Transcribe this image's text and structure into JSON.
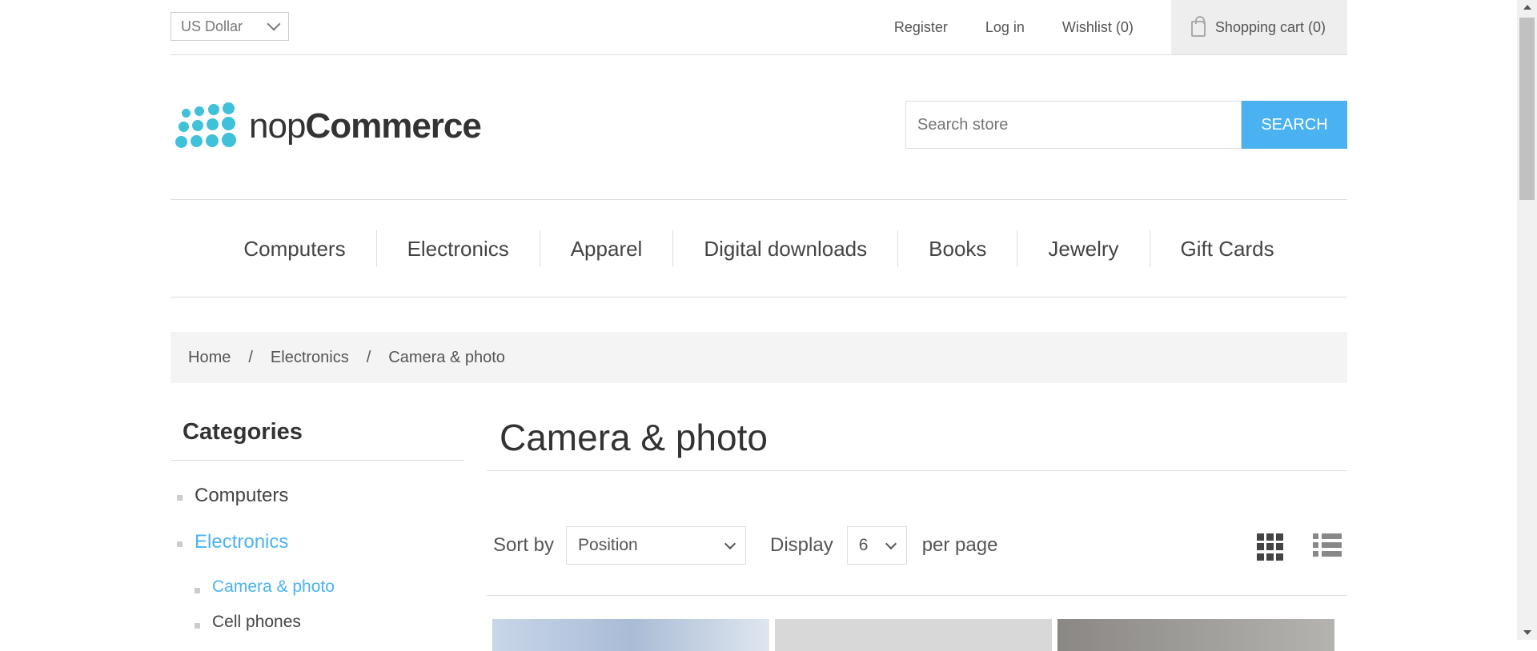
{
  "header": {
    "currency": "US Dollar",
    "links": {
      "register": "Register",
      "login": "Log in",
      "wishlist": "Wishlist (0)",
      "cart": "Shopping cart (0)"
    },
    "logo": {
      "prefix": "nop",
      "bold": "Commerce"
    },
    "search": {
      "placeholder": "Search store",
      "button": "SEARCH"
    }
  },
  "nav": [
    "Computers",
    "Electronics",
    "Apparel",
    "Digital downloads",
    "Books",
    "Jewelry",
    "Gift Cards"
  ],
  "breadcrumb": [
    "Home",
    "Electronics",
    "Camera & photo"
  ],
  "sidebar": {
    "title": "Categories",
    "items": [
      {
        "label": "Computers"
      },
      {
        "label": "Electronics"
      },
      {
        "label": "Camera & photo"
      },
      {
        "label": "Cell phones"
      }
    ]
  },
  "main": {
    "title": "Camera & photo",
    "sort_label": "Sort by",
    "sort_value": "Position",
    "display_label": "Display",
    "display_value": "6",
    "per_page": "per page"
  },
  "colors": {
    "accent": "#4ab2f1",
    "logo": "#3fc1d9"
  }
}
